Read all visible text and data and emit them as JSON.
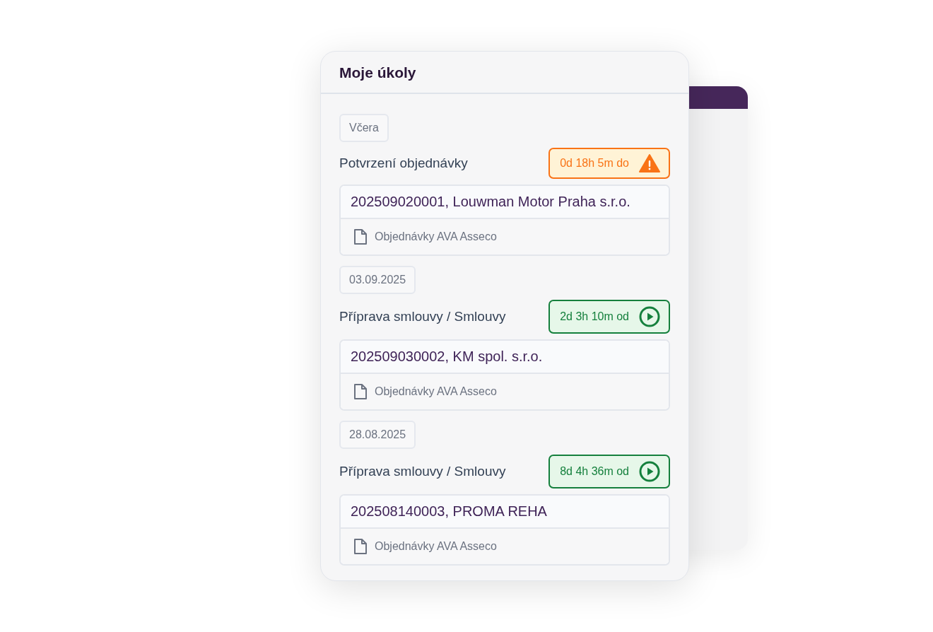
{
  "panel": {
    "title": "Moje úkoly"
  },
  "groups": [
    {
      "date": "Včera",
      "task": {
        "title": "Potvrzení objednávky",
        "timer": {
          "kind": "warning",
          "text": "0d 18h 5m do"
        },
        "record": "202509020001, Louwman Motor Praha s.r.o.",
        "source": "Objednávky AVA Asseco"
      }
    },
    {
      "date": "03.09.2025",
      "task": {
        "title": "Příprava smlouvy / Smlouvy",
        "timer": {
          "kind": "running",
          "text": "2d 3h 10m od"
        },
        "record": "202509030002, KM spol. s.r.o.",
        "source": "Objednávky AVA Asseco"
      }
    },
    {
      "date": "28.08.2025",
      "task": {
        "title": "Příprava smlouvy / Smlouvy",
        "timer": {
          "kind": "running",
          "text": "8d 4h 36m od"
        },
        "record": "202508140003, PROMA REHA",
        "source": "Objednávky AVA Asseco"
      }
    }
  ]
}
